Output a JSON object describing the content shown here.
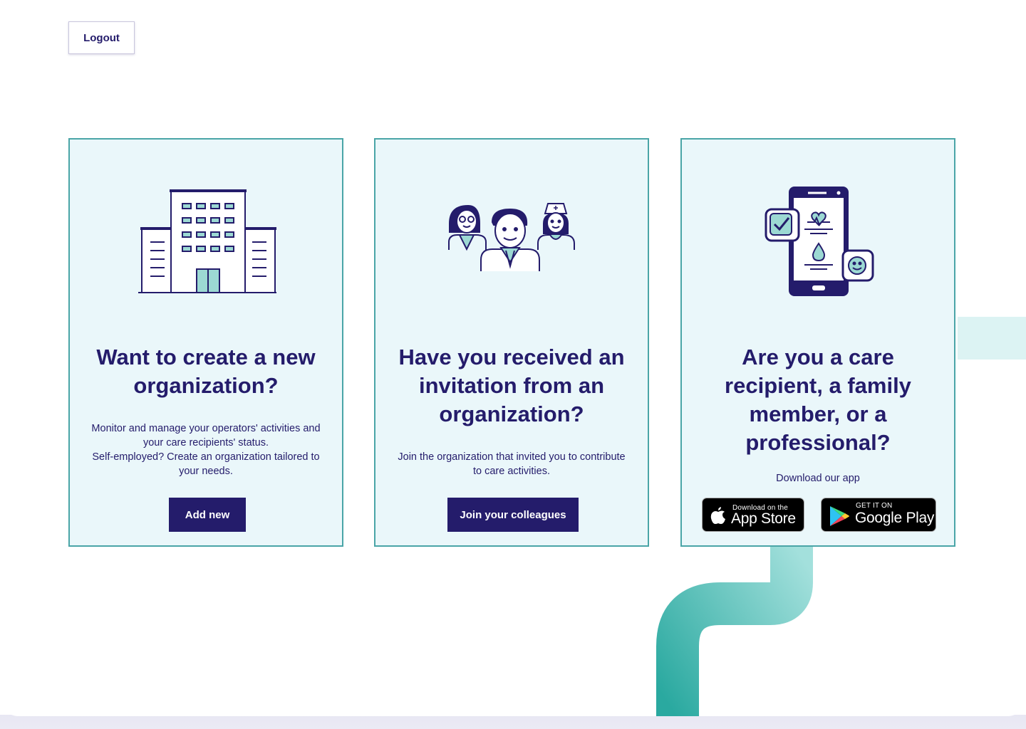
{
  "header": {
    "logout_label": "Logout"
  },
  "cards": [
    {
      "illustration": "building-icon",
      "title": "Want to create a new organization?",
      "description_lines": [
        "Monitor and manage your operators' activities and",
        "your care recipients' status.",
        "Self-employed? Create an organization tailored to",
        "your needs."
      ],
      "button_label": "Add new"
    },
    {
      "illustration": "care-team-icon",
      "title": "Have you received an invitation from an organization?",
      "description_lines": [
        "Join the organization that invited you to contribute",
        "to care activities."
      ],
      "button_label": "Join your colleagues"
    },
    {
      "illustration": "mobile-health-app-icon",
      "title": "Are you a care recipient, a family member, or a professional?",
      "description_lines": [
        "Download our app"
      ],
      "app_store": {
        "small": "Download on the",
        "big": "App Store",
        "icon": "apple-icon"
      },
      "google_play": {
        "small": "GET IT ON",
        "big": "Google Play",
        "icon": "google-play-icon"
      }
    }
  ],
  "colors": {
    "primary": "#241c6b",
    "card_background": "#eaf7fa",
    "card_border": "#4aa5a7",
    "accent_teal": "#8fd3d0"
  }
}
